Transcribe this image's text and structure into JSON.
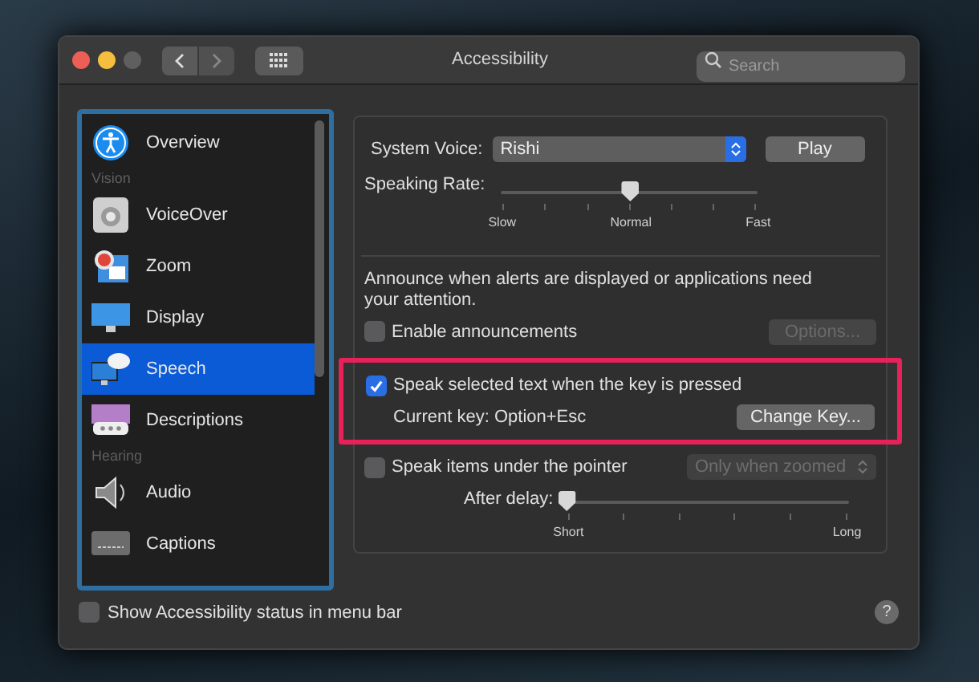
{
  "window": {
    "title": "Accessibility"
  },
  "search": {
    "placeholder": "Search"
  },
  "sidebar": {
    "items": [
      {
        "kind": "item",
        "label": "Overview",
        "selected": false
      },
      {
        "kind": "header",
        "label": "Vision"
      },
      {
        "kind": "item",
        "label": "VoiceOver",
        "selected": false
      },
      {
        "kind": "item",
        "label": "Zoom",
        "selected": false
      },
      {
        "kind": "item",
        "label": "Display",
        "selected": false
      },
      {
        "kind": "item",
        "label": "Speech",
        "selected": true
      },
      {
        "kind": "item",
        "label": "Descriptions",
        "selected": false
      },
      {
        "kind": "header",
        "label": "Hearing"
      },
      {
        "kind": "item",
        "label": "Audio",
        "selected": false
      },
      {
        "kind": "item",
        "label": "Captions",
        "selected": false
      }
    ]
  },
  "voice": {
    "label": "System Voice:",
    "value": "Rishi",
    "button": "Play"
  },
  "rate": {
    "label": "Speaking Rate:",
    "level": 0.5,
    "ticks": [
      "Slow",
      "Normal",
      "Fast"
    ]
  },
  "announce": {
    "text": "Announce when alerts are displayed or applications need your attention.",
    "checkbox": {
      "label": "Enable announcements",
      "checked": false
    },
    "button": {
      "label": "Options...",
      "disabled": true
    }
  },
  "speak_selected": {
    "checkbox": {
      "label": "Speak selected text when the key is pressed",
      "checked": true
    },
    "current_key": "Current key: Option+Esc",
    "button": "Change Key...",
    "highlighted": true
  },
  "speak_pointer": {
    "checkbox": {
      "label": "Speak items under the pointer",
      "checked": false
    },
    "dropdown": {
      "value": "Only when zoomed",
      "disabled": true
    },
    "delay_label": "After delay:",
    "level": 0,
    "ticks": [
      "Short",
      "Long"
    ]
  },
  "status_checkbox": {
    "label": "Show Accessibility status in menu bar",
    "checked": false
  },
  "help": "?"
}
